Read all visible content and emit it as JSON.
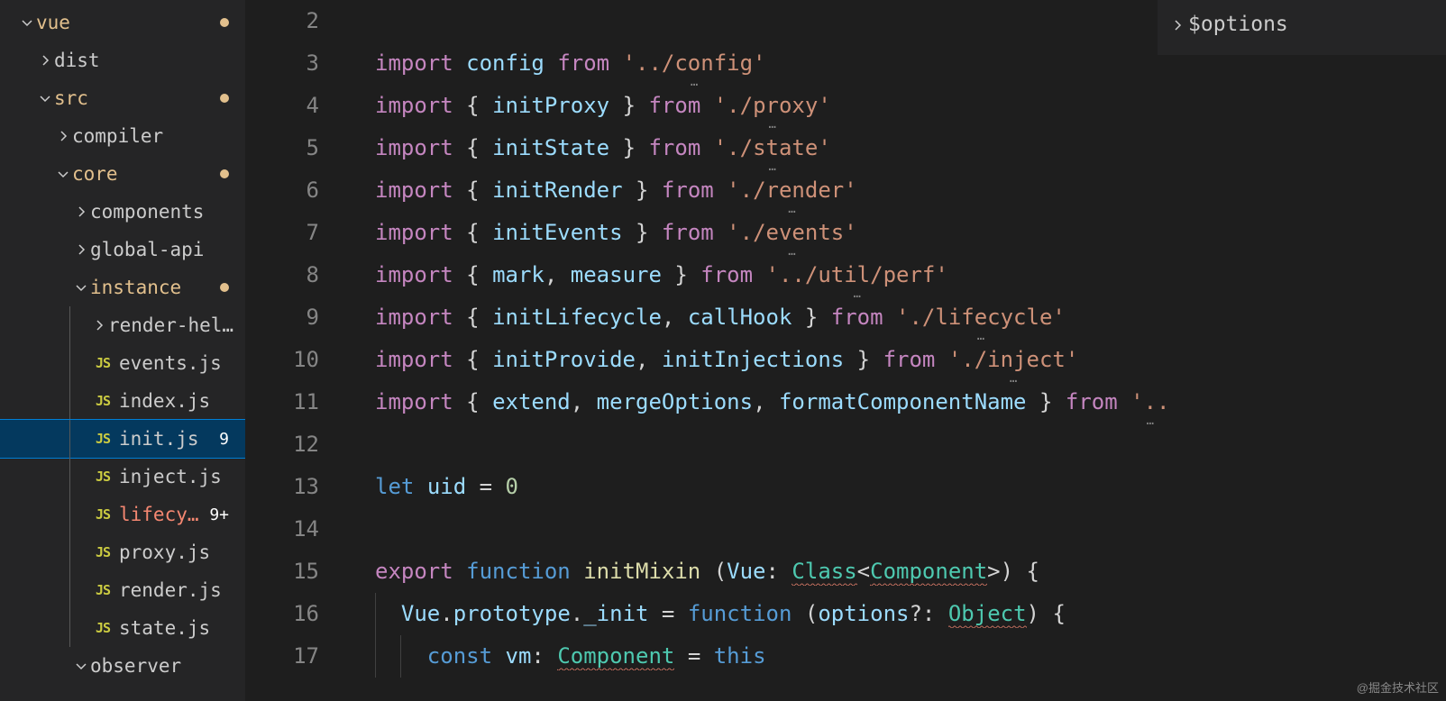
{
  "sidebar": {
    "items": [
      {
        "label": "vue",
        "type": "folder",
        "expanded": true,
        "indent": 20,
        "modified": true,
        "dot": true,
        "chevron": true
      },
      {
        "label": "dist",
        "type": "folder",
        "expanded": false,
        "indent": 40,
        "chevron": true
      },
      {
        "label": "src",
        "type": "folder",
        "expanded": true,
        "indent": 40,
        "modified": true,
        "dot": true,
        "chevron": true
      },
      {
        "label": "compiler",
        "type": "folder",
        "expanded": false,
        "indent": 60,
        "chevron": true
      },
      {
        "label": "core",
        "type": "folder",
        "expanded": true,
        "indent": 60,
        "modified": true,
        "dot": true,
        "chevron": true
      },
      {
        "label": "components",
        "type": "folder",
        "expanded": false,
        "indent": 80,
        "chevron": true
      },
      {
        "label": "global-api",
        "type": "folder",
        "expanded": false,
        "indent": 80,
        "chevron": true
      },
      {
        "label": "instance",
        "type": "folder",
        "expanded": true,
        "indent": 80,
        "modified": true,
        "dot": true,
        "chevron": true
      },
      {
        "label": "render-hel…",
        "type": "folder",
        "expanded": false,
        "indent": 100,
        "guide": true,
        "chevron": true
      },
      {
        "label": "events.js",
        "type": "file",
        "icon": "js",
        "indent": 100,
        "guide": true
      },
      {
        "label": "index.js",
        "type": "file",
        "icon": "js",
        "indent": 100,
        "guide": true
      },
      {
        "label": "init.js",
        "type": "file",
        "icon": "js",
        "indent": 100,
        "guide": true,
        "selected": true,
        "badge": "9"
      },
      {
        "label": "inject.js",
        "type": "file",
        "icon": "js",
        "indent": 100,
        "guide": true
      },
      {
        "label": "lifecy…",
        "type": "file",
        "icon": "js",
        "indent": 100,
        "guide": true,
        "error": true,
        "badge": "9+"
      },
      {
        "label": "proxy.js",
        "type": "file",
        "icon": "js",
        "indent": 100,
        "guide": true
      },
      {
        "label": "render.js",
        "type": "file",
        "icon": "js",
        "indent": 100,
        "guide": true
      },
      {
        "label": "state.js",
        "type": "file",
        "icon": "js",
        "indent": 100,
        "guide": true
      },
      {
        "label": "observer",
        "type": "folder",
        "expanded": true,
        "indent": 80,
        "chevron": true
      }
    ]
  },
  "outline": {
    "label": "$options"
  },
  "editor": {
    "lines": [
      {
        "n": 2,
        "tokens": []
      },
      {
        "n": 3,
        "tokens": [
          [
            "kw",
            "import"
          ],
          [
            "",
            ""
          ],
          [
            "var",
            "config"
          ],
          [
            "",
            ""
          ],
          [
            "kw",
            "from"
          ],
          [
            "",
            ""
          ],
          [
            "str",
            "'../config'",
            "dots"
          ]
        ]
      },
      {
        "n": 4,
        "tokens": [
          [
            "kw",
            "import"
          ],
          [
            "",
            ""
          ],
          [
            "punc",
            "{"
          ],
          [
            "",
            ""
          ],
          [
            "var",
            "initProxy"
          ],
          [
            "",
            ""
          ],
          [
            "punc",
            "}"
          ],
          [
            "",
            ""
          ],
          [
            "kw",
            "from"
          ],
          [
            "",
            ""
          ],
          [
            "str",
            "'./proxy'",
            "dots"
          ]
        ]
      },
      {
        "n": 5,
        "tokens": [
          [
            "kw",
            "import"
          ],
          [
            "",
            ""
          ],
          [
            "punc",
            "{"
          ],
          [
            "",
            ""
          ],
          [
            "var",
            "initState"
          ],
          [
            "",
            ""
          ],
          [
            "punc",
            "}"
          ],
          [
            "",
            ""
          ],
          [
            "kw",
            "from"
          ],
          [
            "",
            ""
          ],
          [
            "str",
            "'./state'",
            "dots"
          ]
        ]
      },
      {
        "n": 6,
        "tokens": [
          [
            "kw",
            "import"
          ],
          [
            "",
            ""
          ],
          [
            "punc",
            "{"
          ],
          [
            "",
            ""
          ],
          [
            "var",
            "initRender"
          ],
          [
            "",
            ""
          ],
          [
            "punc",
            "}"
          ],
          [
            "",
            ""
          ],
          [
            "kw",
            "from"
          ],
          [
            "",
            ""
          ],
          [
            "str",
            "'./render'",
            "dots"
          ]
        ]
      },
      {
        "n": 7,
        "tokens": [
          [
            "kw",
            "import"
          ],
          [
            "",
            ""
          ],
          [
            "punc",
            "{"
          ],
          [
            "",
            ""
          ],
          [
            "var",
            "initEvents"
          ],
          [
            "",
            ""
          ],
          [
            "punc",
            "}"
          ],
          [
            "",
            ""
          ],
          [
            "kw",
            "from"
          ],
          [
            "",
            ""
          ],
          [
            "str",
            "'./events'",
            "dots"
          ]
        ]
      },
      {
        "n": 8,
        "tokens": [
          [
            "kw",
            "import"
          ],
          [
            "",
            ""
          ],
          [
            "punc",
            "{"
          ],
          [
            "",
            ""
          ],
          [
            "var",
            "mark"
          ],
          [
            "punc",
            ","
          ],
          [
            "",
            ""
          ],
          [
            "var",
            "measure"
          ],
          [
            "",
            ""
          ],
          [
            "punc",
            "}"
          ],
          [
            "",
            ""
          ],
          [
            "kw",
            "from"
          ],
          [
            "",
            ""
          ],
          [
            "str",
            "'../util/perf'",
            "dots"
          ]
        ]
      },
      {
        "n": 9,
        "tokens": [
          [
            "kw",
            "import"
          ],
          [
            "",
            ""
          ],
          [
            "punc",
            "{"
          ],
          [
            "",
            ""
          ],
          [
            "var",
            "initLifecycle"
          ],
          [
            "punc",
            ","
          ],
          [
            "",
            ""
          ],
          [
            "var",
            "callHook"
          ],
          [
            "",
            ""
          ],
          [
            "punc",
            "}"
          ],
          [
            "",
            ""
          ],
          [
            "kw",
            "from"
          ],
          [
            "",
            ""
          ],
          [
            "str",
            "'./lifecycle'",
            "dots"
          ]
        ]
      },
      {
        "n": 10,
        "tokens": [
          [
            "kw",
            "import"
          ],
          [
            "",
            ""
          ],
          [
            "punc",
            "{"
          ],
          [
            "",
            ""
          ],
          [
            "var",
            "initProvide"
          ],
          [
            "punc",
            ","
          ],
          [
            "",
            ""
          ],
          [
            "var",
            "initInjections"
          ],
          [
            "",
            ""
          ],
          [
            "punc",
            "}"
          ],
          [
            "",
            ""
          ],
          [
            "kw",
            "from"
          ],
          [
            "",
            ""
          ],
          [
            "str",
            "'./inject'",
            "dots"
          ]
        ]
      },
      {
        "n": 11,
        "tokens": [
          [
            "kw",
            "import"
          ],
          [
            "",
            ""
          ],
          [
            "punc",
            "{"
          ],
          [
            "",
            ""
          ],
          [
            "var",
            "extend"
          ],
          [
            "punc",
            ","
          ],
          [
            "",
            ""
          ],
          [
            "var",
            "mergeOptions"
          ],
          [
            "punc",
            ","
          ],
          [
            "",
            ""
          ],
          [
            "var",
            "formatComponentName"
          ],
          [
            "",
            ""
          ],
          [
            "punc",
            "}"
          ],
          [
            "",
            ""
          ],
          [
            "kw",
            "from"
          ],
          [
            "",
            ""
          ],
          [
            "str",
            "'..",
            "dots"
          ]
        ]
      },
      {
        "n": 12,
        "tokens": []
      },
      {
        "n": 13,
        "tokens": [
          [
            "storage",
            "let"
          ],
          [
            "",
            ""
          ],
          [
            "var",
            "uid"
          ],
          [
            "",
            ""
          ],
          [
            "punc",
            "="
          ],
          [
            "",
            ""
          ],
          [
            "num",
            "0"
          ]
        ]
      },
      {
        "n": 14,
        "tokens": []
      },
      {
        "n": 15,
        "tokens": [
          [
            "kw",
            "export"
          ],
          [
            "",
            ""
          ],
          [
            "storage",
            "function"
          ],
          [
            "",
            ""
          ],
          [
            "fn",
            "initMixin"
          ],
          [
            "",
            ""
          ],
          [
            "punc",
            "("
          ],
          [
            "var",
            "Vue"
          ],
          [
            "punc",
            ":"
          ],
          [
            "",
            ""
          ],
          [
            "type",
            "Class",
            "sq"
          ],
          [
            "punc",
            "<"
          ],
          [
            "type",
            "Component",
            "sq"
          ],
          [
            "punc",
            ">"
          ],
          [
            "punc",
            ")"
          ],
          [
            "",
            ""
          ],
          [
            "punc",
            "{"
          ]
        ]
      },
      {
        "n": 16,
        "tokens": [
          [
            "",
            "  "
          ],
          [
            "var",
            "Vue"
          ],
          [
            "punc",
            "."
          ],
          [
            "var",
            "prototype"
          ],
          [
            "punc",
            "."
          ],
          [
            "var",
            "_init"
          ],
          [
            "",
            ""
          ],
          [
            "punc",
            "="
          ],
          [
            "",
            ""
          ],
          [
            "storage",
            "function"
          ],
          [
            "",
            ""
          ],
          [
            "punc",
            "("
          ],
          [
            "var",
            "options"
          ],
          [
            "punc",
            "?:"
          ],
          [
            "",
            ""
          ],
          [
            "type",
            "Object",
            "sq"
          ],
          [
            "punc",
            ")"
          ],
          [
            "",
            ""
          ],
          [
            "punc",
            "{"
          ]
        ],
        "guides": [
          0
        ]
      },
      {
        "n": 17,
        "tokens": [
          [
            "",
            "    "
          ],
          [
            "storage",
            "const"
          ],
          [
            "",
            ""
          ],
          [
            "var",
            "vm"
          ],
          [
            "punc",
            ":"
          ],
          [
            "",
            ""
          ],
          [
            "type",
            "Component",
            "sq"
          ],
          [
            "",
            ""
          ],
          [
            "punc",
            "="
          ],
          [
            "",
            ""
          ],
          [
            "storage",
            "this"
          ]
        ],
        "guides": [
          0,
          1
        ]
      }
    ]
  },
  "watermark": "@掘金技术社区"
}
